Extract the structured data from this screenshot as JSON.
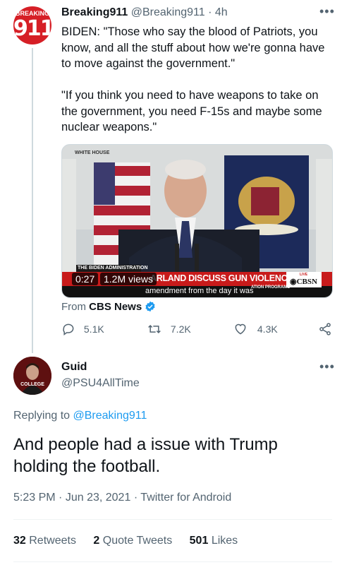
{
  "tweet": {
    "avatar_text_top": "BREAKING",
    "avatar_text_number": "911",
    "display_name": "Breaking911",
    "handle": "@Breaking911",
    "separator": "·",
    "time": "4h",
    "text": "BIDEN: \"Those who say the blood of Patriots, you know, and all the stuff about how we're gonna have to move against the government.\"\n\n\"If you think you need to have weapons to take on the government, you need F-15s and maybe some nuclear weapons.\"",
    "media": {
      "corner_label": "WHITE HOUSE",
      "banner_top": "THE BIDEN ADMINISTRATION",
      "timecode": "0:27",
      "views": "1.2M views",
      "headline": "ARLAND DISCUSS GUN VIOLENCE",
      "tag": "ATION PROGRAMS",
      "caption": "amendment from the day it was",
      "live_label": "LIVE",
      "network": "CBSN"
    },
    "source_prefix": "From",
    "source_name": "CBS News",
    "counts": {
      "replies": "5.1K",
      "retweets": "7.2K",
      "likes": "4.3K"
    }
  },
  "reply": {
    "display_name": "Guid",
    "handle": "@PSU4AllTime",
    "avatar_text": "COLLEGE",
    "replying_prefix": "Replying to",
    "replying_handle": "@Breaking911",
    "text": "And people had a issue with Trump holding the football.",
    "time": "5:23 PM",
    "date": "Jun 23, 2021",
    "client": "Twitter for Android",
    "dot": "·"
  },
  "stats": {
    "retweets_count": "32",
    "retweets_label": "Retweets",
    "quotes_count": "2",
    "quotes_label": "Quote Tweets",
    "likes_count": "501",
    "likes_label": "Likes"
  },
  "icons": [
    "more-icon",
    "reply-icon",
    "retweet-icon",
    "like-icon",
    "share-icon",
    "verified-icon"
  ],
  "colors": {
    "accent": "#1d9bf0",
    "brand_red": "#d61f26",
    "text": "#0f1419",
    "muted": "#536471"
  }
}
